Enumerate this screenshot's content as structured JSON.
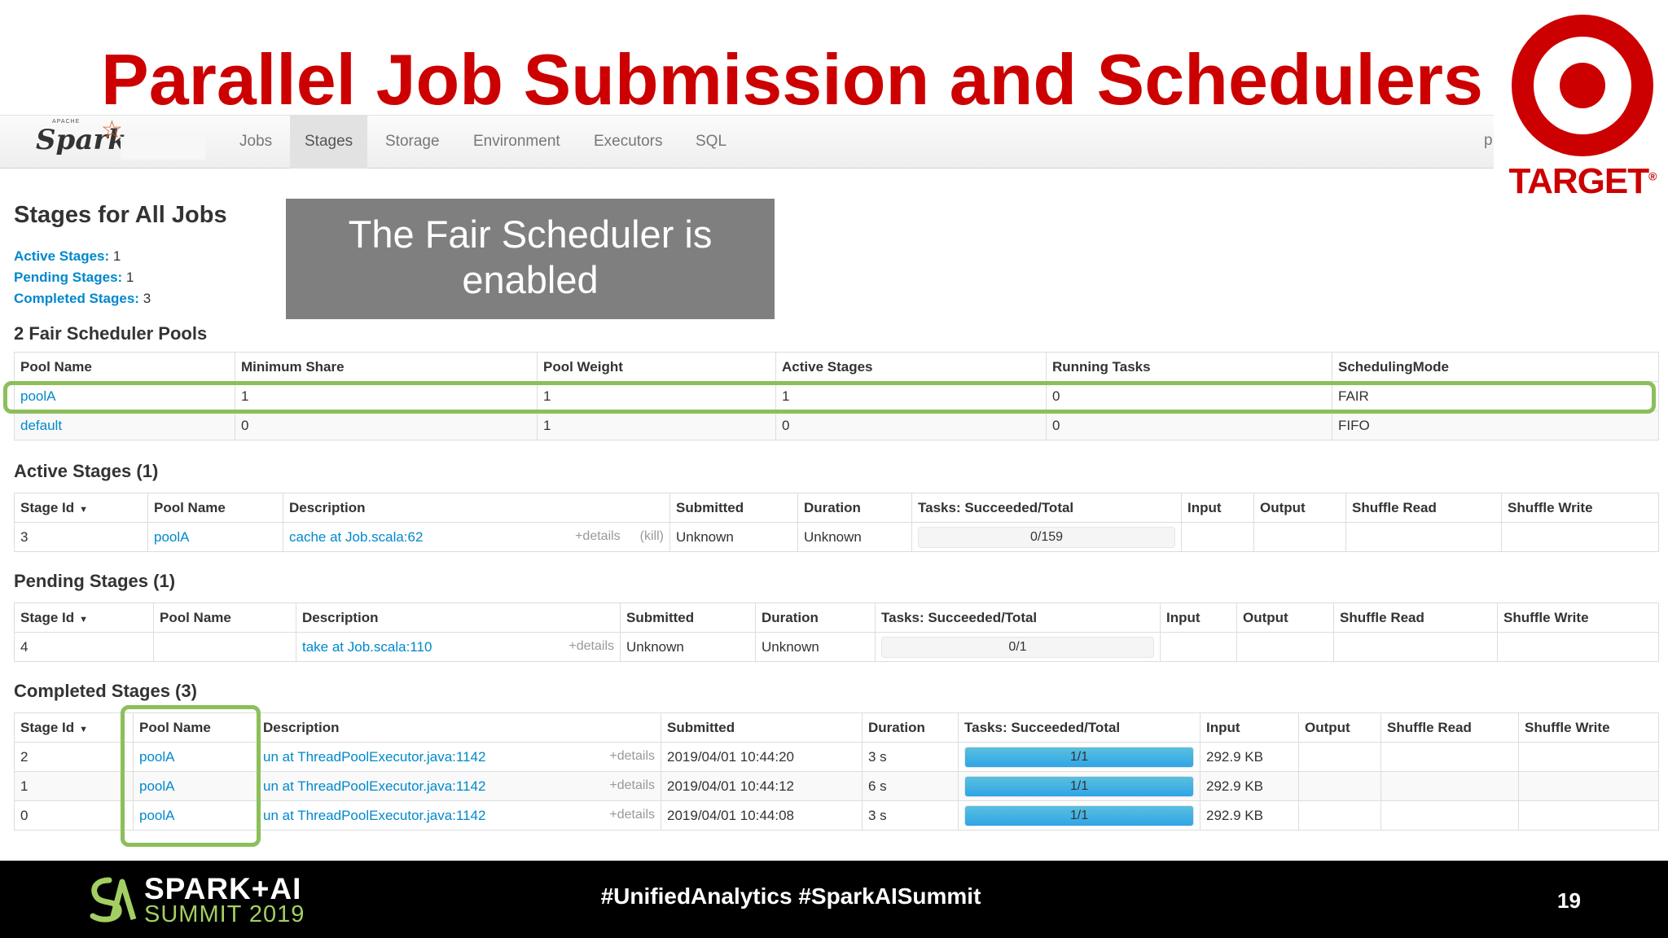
{
  "slide": {
    "title": "Parallel Job Submission and Schedulers",
    "callout": "The Fair Scheduler is enabled",
    "logo_word": "TARGET",
    "logo_mark": "®"
  },
  "navbar": {
    "brand_small": "APACHE",
    "brand": "Spark",
    "tabs": [
      "Jobs",
      "Stages",
      "Storage",
      "Environment",
      "Executors",
      "SQL"
    ],
    "active_tab": "Stages",
    "right_letter": "p"
  },
  "page": {
    "heading": "Stages for All Jobs",
    "summary": [
      {
        "label": "Active Stages:",
        "value": "1"
      },
      {
        "label": "Pending Stages:",
        "value": "1"
      },
      {
        "label": "Completed Stages:",
        "value": "3"
      }
    ]
  },
  "pools": {
    "heading": "2 Fair Scheduler Pools",
    "columns": [
      "Pool Name",
      "Minimum Share",
      "Pool Weight",
      "Active Stages",
      "Running Tasks",
      "SchedulingMode"
    ],
    "rows": [
      [
        "poolA",
        "1",
        "1",
        "1",
        "0",
        "FAIR"
      ],
      [
        "default",
        "0",
        "1",
        "0",
        "0",
        "FIFO"
      ]
    ]
  },
  "active": {
    "heading": "Active Stages (1)",
    "columns": [
      "Stage Id",
      "Pool Name",
      "Description",
      "Submitted",
      "Duration",
      "Tasks: Succeeded/Total",
      "Input",
      "Output",
      "Shuffle Read",
      "Shuffle Write"
    ],
    "rows": [
      {
        "id": "3",
        "pool": "poolA",
        "desc": "cache at Job.scala:62",
        "details": "+details",
        "kill": "(kill)",
        "submitted": "Unknown",
        "duration": "Unknown",
        "tasks": "0/159",
        "progress": 0,
        "input": "",
        "output": "",
        "shuffle_read": "",
        "shuffle_write": ""
      }
    ]
  },
  "pending": {
    "heading": "Pending Stages (1)",
    "columns": [
      "Stage Id",
      "Pool Name",
      "Description",
      "Submitted",
      "Duration",
      "Tasks: Succeeded/Total",
      "Input",
      "Output",
      "Shuffle Read",
      "Shuffle Write"
    ],
    "rows": [
      {
        "id": "4",
        "pool": "",
        "desc": "take at Job.scala:110",
        "details": "+details",
        "submitted": "Unknown",
        "duration": "Unknown",
        "tasks": "0/1",
        "progress": 0,
        "input": "",
        "output": "",
        "shuffle_read": "",
        "shuffle_write": ""
      }
    ]
  },
  "completed": {
    "heading": "Completed Stages (3)",
    "columns": [
      "Stage Id",
      "Pool Name",
      "Description",
      "Submitted",
      "Duration",
      "Tasks: Succeeded/Total",
      "Input",
      "Output",
      "Shuffle Read",
      "Shuffle Write"
    ],
    "rows": [
      {
        "id": "2",
        "pool": "poolA",
        "desc": "un at ThreadPoolExecutor.java:1142",
        "details": "+details",
        "submitted": "2019/04/01 10:44:20",
        "duration": "3 s",
        "tasks": "1/1",
        "progress": 1,
        "input": "292.9 KB",
        "output": "",
        "shuffle_read": "",
        "shuffle_write": ""
      },
      {
        "id": "1",
        "pool": "poolA",
        "desc": "un at ThreadPoolExecutor.java:1142",
        "details": "+details",
        "submitted": "2019/04/01 10:44:12",
        "duration": "6 s",
        "tasks": "1/1",
        "progress": 1,
        "input": "292.9 KB",
        "output": "",
        "shuffle_read": "",
        "shuffle_write": ""
      },
      {
        "id": "0",
        "pool": "poolA",
        "desc": "un at ThreadPoolExecutor.java:1142",
        "details": "+details",
        "submitted": "2019/04/01 10:44:08",
        "duration": "3 s",
        "tasks": "1/1",
        "progress": 1,
        "input": "292.9 KB",
        "output": "",
        "shuffle_read": "",
        "shuffle_write": ""
      }
    ]
  },
  "footer": {
    "summit_line1": "SPARK+AI",
    "summit_line2": "SUMMIT 2019",
    "hashtags": "#UnifiedAnalytics #SparkAISummit",
    "page_number": "19"
  },
  "colors": {
    "title_red": "#cc0000",
    "link_blue": "#0088cc",
    "highlight_green": "#8bbf5a",
    "progress_blue": "#2fa4e7",
    "summit_green": "#a3cf62"
  },
  "icons": {
    "sort": "sort-down-icon",
    "target": "target-logo-icon",
    "spark": "spark-star-icon",
    "summit": "spark-ai-summit-logo-icon"
  }
}
